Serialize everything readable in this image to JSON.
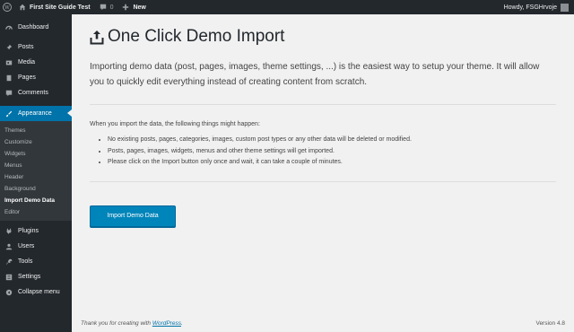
{
  "adminbar": {
    "site_name": "First Site Guide Test",
    "comments_count": "0",
    "new_label": "New",
    "howdy": "Howdy, FSGHrvoje"
  },
  "sidebar": {
    "items": [
      {
        "label": "Dashboard",
        "icon": "dashboard-icon"
      },
      {
        "label": "Posts",
        "icon": "pin-icon"
      },
      {
        "label": "Media",
        "icon": "media-icon"
      },
      {
        "label": "Pages",
        "icon": "page-icon"
      },
      {
        "label": "Comments",
        "icon": "comment-icon"
      },
      {
        "label": "Appearance",
        "icon": "brush-icon"
      },
      {
        "label": "Plugins",
        "icon": "plug-icon"
      },
      {
        "label": "Users",
        "icon": "users-icon"
      },
      {
        "label": "Tools",
        "icon": "wrench-icon"
      },
      {
        "label": "Settings",
        "icon": "settings-icon"
      },
      {
        "label": "Collapse menu",
        "icon": "collapse-icon"
      }
    ],
    "appearance_submenu": [
      "Themes",
      "Customize",
      "Widgets",
      "Menus",
      "Header",
      "Background",
      "Import Demo Data",
      "Editor"
    ]
  },
  "main": {
    "title": "One Click Demo Import",
    "intro": "Importing demo data (post, pages, images, theme settings, ...) is the easiest way to setup your theme. It will allow you to quickly edit everything instead of creating content from scratch.",
    "notice_head": "When you import the data, the following things might happen:",
    "notices": [
      "No existing posts, pages, categories, images, custom post types or any other data will be deleted or modified.",
      "Posts, pages, images, widgets, menus and other theme settings will get imported.",
      "Please click on the Import button only once and wait, it can take a couple of minutes."
    ],
    "import_button": "Import Demo Data"
  },
  "footer": {
    "thanks_prefix": "Thank you for creating with ",
    "wp_link": "WordPress",
    "thanks_suffix": ".",
    "version": "Version 4.8"
  },
  "colors": {
    "accent": "#0073aa",
    "button": "#0085ba",
    "sidebar": "#23282d",
    "submenu": "#32373c"
  }
}
